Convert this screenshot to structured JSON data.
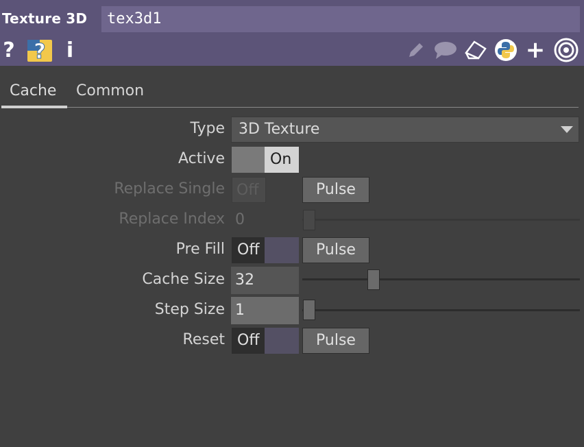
{
  "header": {
    "op_type": "Texture 3D",
    "op_name": "tex3d1",
    "icons": [
      "help-icon",
      "python-help-icon",
      "info-icon",
      "pencil-icon",
      "comment-icon",
      "clone-icon",
      "python-icon",
      "add-icon",
      "target-icon"
    ],
    "icon_glyphs": {
      "help": "?",
      "python_help": "?",
      "info": "i",
      "add": "+"
    },
    "colors": {
      "background": "#5c5478",
      "name_field": "#6f668d"
    }
  },
  "tabs": [
    {
      "label": "Cache",
      "active": true
    },
    {
      "label": "Common",
      "active": false
    }
  ],
  "params": {
    "type": {
      "label": "Type",
      "value": "3D Texture"
    },
    "active": {
      "label": "Active",
      "value": "On"
    },
    "replace_single": {
      "label": "Replace Single",
      "value": "Off",
      "pulse": "Pulse",
      "enabled": false
    },
    "replace_index": {
      "label": "Replace Index",
      "value": "0",
      "enabled": false
    },
    "pre_fill": {
      "label": "Pre Fill",
      "value": "Off",
      "pulse": "Pulse"
    },
    "cache_size": {
      "label": "Cache Size",
      "value": "32"
    },
    "step_size": {
      "label": "Step Size",
      "value": "1"
    },
    "reset": {
      "label": "Reset",
      "value": "Off",
      "pulse": "Pulse"
    }
  },
  "colors": {
    "panel": "#404040",
    "python_yellow": "#f2c84b",
    "python_blue": "#3b6fa8"
  }
}
